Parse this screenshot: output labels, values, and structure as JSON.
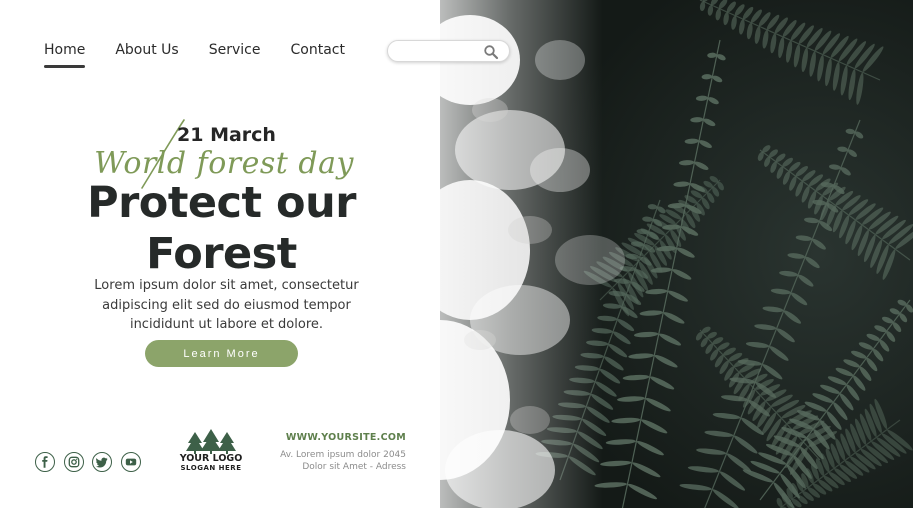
{
  "nav": {
    "items": [
      {
        "label": "Home",
        "active": true
      },
      {
        "label": "About Us",
        "active": false
      },
      {
        "label": "Service",
        "active": false
      },
      {
        "label": "Contact",
        "active": false
      }
    ]
  },
  "search": {
    "value": "",
    "placeholder": "",
    "icon": "search-icon"
  },
  "hero": {
    "date": "21 March",
    "script": "World forest day",
    "headline_line1": "Protect our",
    "headline_line2": "Forest",
    "body_line1": "Lorem ipsum dolor sit amet, consectetur",
    "body_line2": "adipiscing elit sed do eiusmod tempor",
    "body_line3": "incididunt ut labore et dolore.",
    "cta_label": "Learn More"
  },
  "footer": {
    "social": [
      "facebook-icon",
      "instagram-icon",
      "twitter-icon",
      "youtube-icon"
    ],
    "logo_name": "YOUR LOGO",
    "logo_slogan": "SLOGAN HERE",
    "website": "WWW.YOURSITE.COM",
    "address_line1": "Av. Lorem ipsum dolor 2045",
    "address_line2": "Dolor sit Amet - Adress"
  },
  "colors": {
    "accent": "#8ca46a",
    "script": "#7f9a58",
    "headline": "#262a29",
    "footer_green": "#3d6048",
    "fern_dark": "#1e2722",
    "fern_leaf": "#56695c"
  }
}
